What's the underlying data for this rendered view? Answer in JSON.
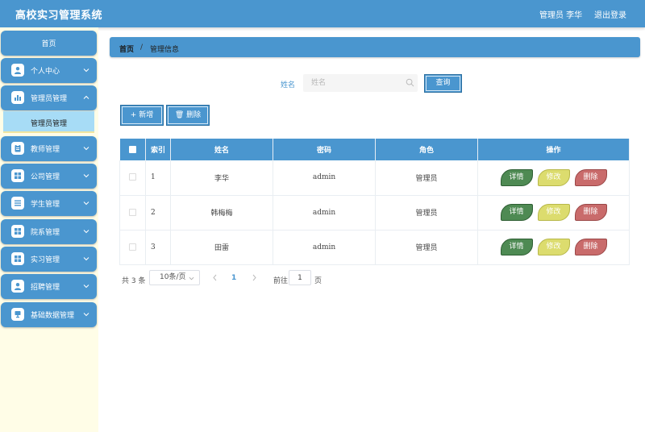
{
  "app": {
    "title": "高校实习管理系统",
    "user": "管理员 李华",
    "logout": "退出登录"
  },
  "sidebar": {
    "home": "首页",
    "items": [
      {
        "label": "个人中心",
        "icon": "person-icon"
      },
      {
        "label": "管理员管理",
        "icon": "bar-chart-icon",
        "expanded": true
      },
      {
        "label": "教师管理",
        "icon": "clipboard-icon"
      },
      {
        "label": "公司管理",
        "icon": "grid-icon"
      },
      {
        "label": "学生管理",
        "icon": "list-icon"
      },
      {
        "label": "院系管理",
        "icon": "grid-icon"
      },
      {
        "label": "实习管理",
        "icon": "grid-icon"
      },
      {
        "label": "招聘管理",
        "icon": "person-icon"
      },
      {
        "label": "基础数据管理",
        "icon": "monitor-icon"
      }
    ],
    "sub_item": "管理员管理"
  },
  "breadcrumb": {
    "home": "首页",
    "separator": "/",
    "current": "管理信息"
  },
  "search": {
    "label": "姓名",
    "placeholder": "姓名",
    "value": "",
    "button": "查询"
  },
  "toolbar": {
    "add": "新增",
    "delete": "删除"
  },
  "table": {
    "headers": {
      "index": "索引",
      "name": "姓名",
      "password": "密码",
      "role": "角色",
      "actions": "操作"
    },
    "rows": [
      {
        "index": "1",
        "name": "李华",
        "password": "admin",
        "role": "管理员"
      },
      {
        "index": "2",
        "name": "韩梅梅",
        "password": "admin",
        "role": "管理员"
      },
      {
        "index": "3",
        "name": "田雷",
        "password": "admin",
        "role": "管理员"
      }
    ],
    "actions": {
      "detail": "详情",
      "edit": "修改",
      "delete": "删除"
    }
  },
  "pagination": {
    "total": "共 3 条",
    "page_size": "10条/页",
    "current_page": "1",
    "goto": "前往",
    "goto_value": "1",
    "unit": "页"
  },
  "colors": {
    "primary": "#4a96cf",
    "sidebar_bg": "#fffde7",
    "submenu_bg": "#a7dcf6",
    "detail": "#4e8a53",
    "edit": "#dcdc6e",
    "delete": "#c96b6b"
  }
}
